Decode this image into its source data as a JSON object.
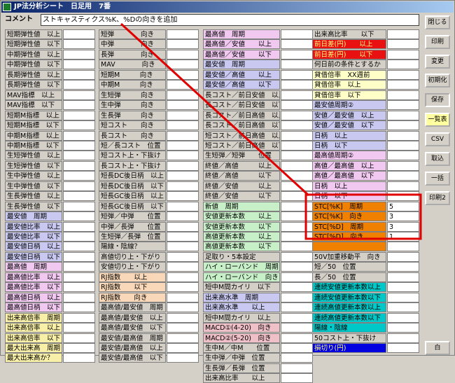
{
  "window": {
    "title": "JP法分析シート　日足用　7番"
  },
  "comment": {
    "label": "コメント",
    "value": "ストキャスティクス%K、%Dの向きを追加"
  },
  "colors": {
    "purple": "#c8c8f0",
    "green": "#c8f0c8",
    "pink": "#f0c8f0",
    "peach": "#f8d8b8",
    "rose": "#f0c0c8",
    "yellow": "#f8f0a8",
    "red": "#e81010",
    "cyan": "#00c8c8",
    "lightyellow": "#ffffc8",
    "orange": "#f08000",
    "blue": "#0000e0",
    "annotation": "#e00000"
  },
  "columns": [
    {
      "label_width": 82,
      "value_width": 46,
      "items": [
        {
          "label": "短期弾性値　以上",
          "value": ""
        },
        {
          "label": "短期弾性値　以下",
          "value": ""
        },
        {
          "label": "中期弾性値　以上",
          "value": ""
        },
        {
          "label": "中期弾性値　以下",
          "value": ""
        },
        {
          "label": "長期弾性値　以上",
          "value": ""
        },
        {
          "label": "長期弾性値　以下",
          "value": ""
        },
        {
          "label": "MAV指標　以上",
          "value": ""
        },
        {
          "label": "MAV指標　以下",
          "value": ""
        },
        {
          "label": "短期M指標　以上",
          "value": ""
        },
        {
          "label": "短期M指標　以下",
          "value": ""
        },
        {
          "label": "中期M指標　以上",
          "value": ""
        },
        {
          "label": "中期M指標　以下",
          "value": ""
        },
        {
          "label": "生短弾性値　以上",
          "value": ""
        },
        {
          "label": "生短弾性値　以下",
          "value": ""
        },
        {
          "label": "生中弾性値　以上",
          "value": ""
        },
        {
          "label": "生中弾性値　以下",
          "value": ""
        },
        {
          "label": "生長弾性値　以上",
          "value": ""
        },
        {
          "label": "生長弾性値　以下",
          "value": ""
        },
        {
          "label": "最安値　周期",
          "value": "",
          "bg": "purple"
        },
        {
          "label": "最安値比率　以上",
          "value": "",
          "bg": "purple"
        },
        {
          "label": "最安値比率　以下",
          "value": "",
          "bg": "purple"
        },
        {
          "label": "最安値日柄　以上",
          "value": "",
          "bg": "purple"
        },
        {
          "label": "最安値日柄　以下",
          "value": "",
          "bg": "purple"
        },
        {
          "label": "最高値　周期",
          "value": "",
          "bg": "pink"
        },
        {
          "label": "最高値比率　以上",
          "value": "",
          "bg": "pink"
        },
        {
          "label": "最高値比率　以下",
          "value": "",
          "bg": "pink"
        },
        {
          "label": "最高値日柄　以上",
          "value": "",
          "bg": "pink"
        },
        {
          "label": "最高値日柄　以下",
          "value": "",
          "bg": "pink"
        },
        {
          "label": "出来高倍率　周期",
          "value": "",
          "bg": "yellow"
        },
        {
          "label": "出来高倍率　以上",
          "value": "",
          "bg": "yellow"
        },
        {
          "label": "出来高倍率　以下",
          "value": "",
          "bg": "yellow"
        },
        {
          "label": "最大出来高　周期",
          "value": "",
          "bg": "yellow"
        },
        {
          "label": "最大出来高か？",
          "value": "",
          "bg": "yellow"
        }
      ]
    },
    {
      "label_width": 96,
      "value_width": 46,
      "items": [
        {
          "label": "短弾　　　　向き",
          "value": ""
        },
        {
          "label": "中弾　　　　向き",
          "value": ""
        },
        {
          "label": "長弾　　　　向き",
          "value": ""
        },
        {
          "label": "MAV　　　　向き",
          "value": ""
        },
        {
          "label": "短期M　　　向き",
          "value": ""
        },
        {
          "label": "中期M　　　向き",
          "value": ""
        },
        {
          "label": "生短弾　　　向き",
          "value": ""
        },
        {
          "label": "生中弾　　　向き",
          "value": ""
        },
        {
          "label": "生長弾　　　向き",
          "value": ""
        },
        {
          "label": "短コスト　　向き",
          "value": ""
        },
        {
          "label": "長コスト　　向き",
          "value": ""
        },
        {
          "label": "短／長コスト　位置",
          "value": ""
        },
        {
          "label": "短コスト上・下抜け",
          "value": ""
        },
        {
          "label": "長コスト上・下抜け",
          "value": ""
        },
        {
          "label": "短長DC後日柄　以上",
          "value": ""
        },
        {
          "label": "短長DC後日柄　以下",
          "value": ""
        },
        {
          "label": "短長GC後日柄　以上",
          "value": ""
        },
        {
          "label": "短長GC後日柄　以下",
          "value": ""
        },
        {
          "label": "短弾／中弾　　位置",
          "value": ""
        },
        {
          "label": "中弾／長弾　　位置",
          "value": ""
        },
        {
          "label": "生短弾／長弾　位置",
          "value": ""
        },
        {
          "label": "陽線・陰線？",
          "value": ""
        },
        {
          "label": "高値切り上・下がり",
          "value": ""
        },
        {
          "label": "安値切り上・下がり",
          "value": ""
        },
        {
          "label": "RJ指数　　以上",
          "value": "",
          "bg": "peach"
        },
        {
          "label": "RJ指数　　以下",
          "value": "",
          "bg": "peach"
        },
        {
          "label": "RJ指数　　向き",
          "value": "",
          "bg": "peach"
        },
        {
          "label": "最高値/最安値　周期",
          "value": ""
        },
        {
          "label": "最高値/最安値　以上",
          "value": ""
        },
        {
          "label": "最高値/最安値　以下",
          "value": ""
        },
        {
          "label": "最安値/最高値　周期",
          "value": ""
        },
        {
          "label": "最安値/最高値　以上",
          "value": ""
        },
        {
          "label": "最安値/最高値　以下",
          "value": ""
        }
      ]
    },
    {
      "label_width": 110,
      "value_width": 46,
      "items": [
        {
          "label": "最高値　周期",
          "value": "",
          "bg": "pink"
        },
        {
          "label": "最高値／安値　　以上",
          "value": "",
          "bg": "pink"
        },
        {
          "label": "最高値／安値　　以下",
          "value": "",
          "bg": "pink"
        },
        {
          "label": "最安値　周期",
          "value": "",
          "bg": "purple"
        },
        {
          "label": "最安値／高値　　以上",
          "value": "",
          "bg": "purple"
        },
        {
          "label": "最安値／高値　　以下",
          "value": "",
          "bg": "purple"
        },
        {
          "label": "長コスト／前日安値　以上",
          "value": ""
        },
        {
          "label": "長コスト／前日安値　以下",
          "value": ""
        },
        {
          "label": "長コスト／前日高値　以上",
          "value": ""
        },
        {
          "label": "長コスト／前日高値　以下",
          "value": ""
        },
        {
          "label": "短コスト／前日高値　以上",
          "value": ""
        },
        {
          "label": "短コスト／前日高値　以下",
          "value": ""
        },
        {
          "label": "生短弾／短弾　　位置",
          "value": ""
        },
        {
          "label": "終値／高値　　　以上",
          "value": ""
        },
        {
          "label": "終値／高値　　　以下",
          "value": ""
        },
        {
          "label": "終値／安値　　　以上",
          "value": ""
        },
        {
          "label": "終値／安値　　　以下",
          "value": ""
        },
        {
          "label": "新値　周期",
          "value": "",
          "bg": "green"
        },
        {
          "label": "安値更新本数　　以上",
          "value": "",
          "bg": "green"
        },
        {
          "label": "安値更新本数　　以下",
          "value": "",
          "bg": "green"
        },
        {
          "label": "高値更新本数　　以上",
          "value": "",
          "bg": "green"
        },
        {
          "label": "高値更新本数　　以下",
          "value": "",
          "bg": "green"
        },
        {
          "label": "足取り・5本設定",
          "value": ""
        },
        {
          "label": "ハイ・ローバンド　周期",
          "value": "",
          "bg": "green"
        },
        {
          "label": "ハイ・ローバンド　向き",
          "value": "",
          "bg": "green"
        },
        {
          "label": "短中M間カイリ　以下",
          "value": ""
        },
        {
          "label": "出来高水準　周期",
          "value": "",
          "bg": "purple"
        },
        {
          "label": "出来高水準　　以上",
          "value": "",
          "bg": "purple"
        },
        {
          "label": "短中M間カイリ　以上",
          "value": ""
        },
        {
          "label": "MACD①(4-20)　向き",
          "value": "",
          "bg": "rose"
        },
        {
          "label": "MACD②(5-20)　向き",
          "value": "",
          "bg": "rose"
        },
        {
          "label": "生中M／中M　　位置",
          "value": ""
        },
        {
          "label": "生中弾／中弾　位置",
          "value": ""
        },
        {
          "label": "生長弾／長弾　位置",
          "value": ""
        },
        {
          "label": "出来高比率　　以上",
          "value": ""
        }
      ]
    },
    {
      "label_width": 106,
      "value_width": 46,
      "items": [
        {
          "label": "出来高比率　　以下",
          "value": ""
        },
        {
          "label": "前日差(円)　　以上",
          "value": "",
          "bg": "red",
          "fg": "#ffff80"
        },
        {
          "label": "前日差(円)　　以下",
          "value": "",
          "bg": "red",
          "fg": "#ffff80"
        },
        {
          "label": "何日前の条件とするか",
          "value": ""
        },
        {
          "label": "貸借倍率　XX週前",
          "value": "",
          "bg": "lightyellow"
        },
        {
          "label": "貸借倍率　以上",
          "value": "",
          "bg": "lightyellow"
        },
        {
          "label": "貸借倍率　以下",
          "value": "",
          "bg": "lightyellow"
        },
        {
          "label": "最安値周期②",
          "value": "",
          "bg": "purple"
        },
        {
          "label": "安値／最安値　以上",
          "value": "",
          "bg": "purple"
        },
        {
          "label": "安値／最安値　以下",
          "value": "",
          "bg": "purple"
        },
        {
          "label": "日柄　以上",
          "value": "",
          "bg": "purple"
        },
        {
          "label": "日柄　以下",
          "value": "",
          "bg": "purple"
        },
        {
          "label": "最高値周期②",
          "value": "",
          "bg": "pink"
        },
        {
          "label": "高値／最高値　以上",
          "value": "",
          "bg": "pink"
        },
        {
          "label": "高値／最高値　以下",
          "value": "",
          "bg": "pink"
        },
        {
          "label": "日柄　以上",
          "value": "",
          "bg": "pink"
        },
        {
          "label": "日柄　以下",
          "value": "",
          "bg": "pink"
        },
        {
          "label": "STC[%K]　周期",
          "value": "5",
          "bg": "orange"
        },
        {
          "label": "STC[%K]　向き",
          "value": "3",
          "bg": "orange"
        },
        {
          "label": "STC[%D]　周期",
          "value": "3",
          "bg": "orange"
        },
        {
          "label": "STC[%D]　向き",
          "value": "1",
          "bg": "orange"
        },
        {
          "label": "",
          "value": "",
          "bg": "orange"
        },
        {
          "label": "50V加重移動平　向き",
          "value": ""
        },
        {
          "label": "短／50　位置",
          "value": ""
        },
        {
          "label": "長／50　位置",
          "value": ""
        },
        {
          "label": "連続安値更新本数以上",
          "value": "",
          "bg": "cyan"
        },
        {
          "label": "連続安値更新本数以下",
          "value": "",
          "bg": "cyan"
        },
        {
          "label": "連続高値更新本数以上",
          "value": "",
          "bg": "cyan"
        },
        {
          "label": "連続高値更新本数以下",
          "value": "",
          "bg": "cyan"
        },
        {
          "label": "陽線・陰線",
          "value": "",
          "bg": "cyan"
        },
        {
          "label": "50コスト上・下抜け",
          "value": ""
        },
        {
          "label": "損切り(円)",
          "value": "",
          "bg": "blue",
          "fg": "#ffff80"
        }
      ]
    }
  ],
  "buttons": [
    {
      "label": "閉じる"
    },
    {
      "label": "印刷"
    },
    {
      "label": "変更"
    },
    {
      "label": "初期化"
    },
    {
      "label": "保存",
      "state": "pressed"
    },
    {
      "label": "一覧表",
      "state": "highlight"
    },
    {
      "label": "CSV"
    },
    {
      "label": "取込"
    },
    {
      "label": "一括"
    },
    {
      "label": "印刷2"
    },
    {
      "label": "白"
    }
  ]
}
